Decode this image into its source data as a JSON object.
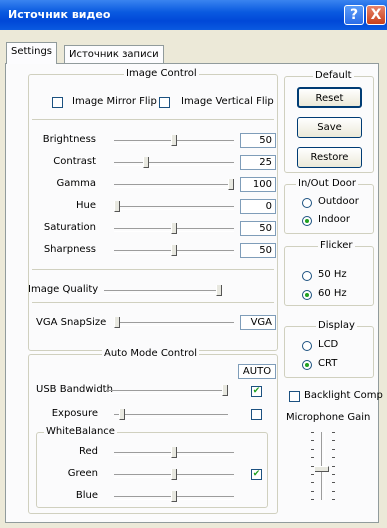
{
  "window": {
    "title": "Источник видео",
    "help_glyph": "?",
    "close_glyph": "X"
  },
  "tabs": [
    {
      "label": "Settings",
      "active": true
    },
    {
      "label": "Источник записи",
      "active": false
    }
  ],
  "image_control": {
    "title": "Image Control",
    "mirror_label": "Image Mirror Flip",
    "mirror_checked": false,
    "vertical_label": "Image Vertical Flip",
    "vertical_checked": false,
    "sliders": [
      {
        "label": "Brightness",
        "value": "50",
        "position": 0.5
      },
      {
        "label": "Contrast",
        "value": "25",
        "position": 0.25
      },
      {
        "label": "Gamma",
        "value": "100",
        "position": 1.0
      },
      {
        "label": "Hue",
        "value": "0",
        "position": 0.0
      },
      {
        "label": "Saturation",
        "value": "50",
        "position": 0.5
      },
      {
        "label": "Sharpness",
        "value": "50",
        "position": 0.5
      }
    ],
    "quality_label": "Image Quality",
    "quality_position": 1.0,
    "snapsize_label": "VGA SnapSize",
    "snapsize_value": "VGA",
    "snapsize_position": 0.0
  },
  "auto_mode": {
    "title": "Auto Mode Control",
    "auto_label": "AUTO",
    "usb_label": "USB Bandwidth",
    "usb_position": 1.0,
    "usb_auto": true,
    "exposure_label": "Exposure",
    "exposure_position": 0.05,
    "exposure_auto": false,
    "wb_title": "WhiteBalance",
    "wb_rows": [
      {
        "label": "Red",
        "position": 0.5
      },
      {
        "label": "Green",
        "position": 0.5
      },
      {
        "label": "Blue",
        "position": 0.5
      }
    ],
    "wb_auto": true
  },
  "default_group": {
    "title": "Default",
    "reset": "Reset",
    "save": "Save",
    "restore": "Restore"
  },
  "inout": {
    "title": "In/Out Door",
    "outdoor": "Outdoor",
    "indoor": "Indoor",
    "selected": "Indoor"
  },
  "flicker": {
    "title": "Flicker",
    "hz50": "50 Hz",
    "hz60": "60 Hz",
    "selected": "60 Hz"
  },
  "display": {
    "title": "Display",
    "lcd": "LCD",
    "crt": "CRT",
    "selected": "CRT"
  },
  "backlight": {
    "label": "Backlight Comp",
    "checked": false
  },
  "mic": {
    "title": "Microphone Gain",
    "position": 0.55
  }
}
